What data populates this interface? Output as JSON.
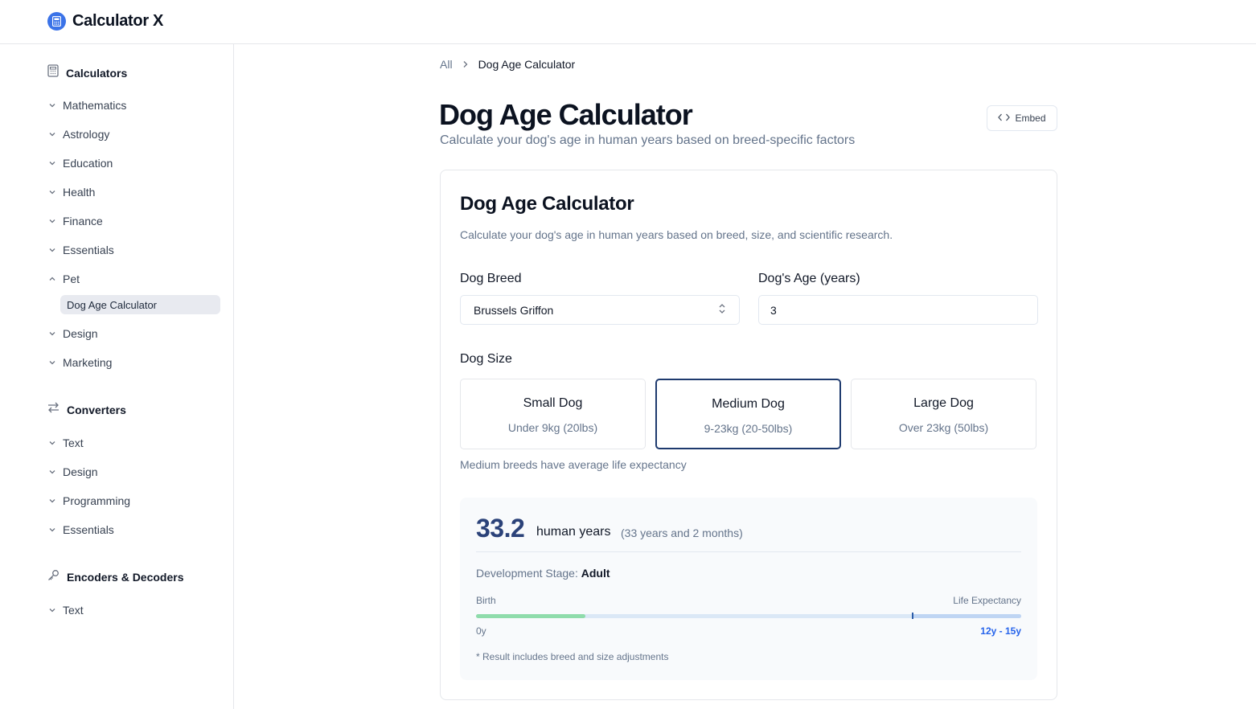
{
  "app": {
    "title": "Calculator X"
  },
  "sidebar": {
    "calculators": {
      "label": "Calculators",
      "items": [
        "Mathematics",
        "Astrology",
        "Education",
        "Health",
        "Finance",
        "Essentials",
        "Pet",
        "Design",
        "Marketing"
      ],
      "expanded": "Pet",
      "active_sub": "Dog Age Calculator"
    },
    "converters": {
      "label": "Converters",
      "items": [
        "Text",
        "Design",
        "Programming",
        "Essentials"
      ]
    },
    "encoders": {
      "label": "Encoders & Decoders",
      "items": [
        "Text"
      ]
    }
  },
  "breadcrumb": {
    "root": "All",
    "current": "Dog Age Calculator"
  },
  "page": {
    "title": "Dog Age Calculator",
    "subtitle": "Calculate your dog's age in human years based on breed-specific factors",
    "embed_label": "Embed"
  },
  "card": {
    "title": "Dog Age Calculator",
    "description": "Calculate your dog's age in human years based on breed, size, and scientific research."
  },
  "form": {
    "breed_label": "Dog Breed",
    "breed_value": "Brussels Griffon",
    "age_label": "Dog's Age (years)",
    "age_value": "3",
    "size_label": "Dog Size",
    "sizes": [
      {
        "name": "Small Dog",
        "range": "Under 9kg (20lbs)",
        "selected": false
      },
      {
        "name": "Medium Dog",
        "range": "9-23kg (20-50lbs)",
        "selected": true
      },
      {
        "name": "Large Dog",
        "range": "Over 23kg (50lbs)",
        "selected": false
      }
    ],
    "size_note": "Medium breeds have average life expectancy"
  },
  "result": {
    "value": "33.2",
    "unit": "human years",
    "detail": "(33 years and 2 months)",
    "stage_label": "Development Stage:",
    "stage_value": "Adult",
    "bar_left_label": "Birth",
    "bar_right_label": "Life Expectancy",
    "bar_min": "0y",
    "bar_max": "12y - 15y",
    "progress_fraction": 0.2,
    "expectancy_start_fraction": 0.8,
    "footnote": "* Result includes breed and size adjustments"
  },
  "colors": {
    "accent": "#2b4279",
    "logo": "#3b73e8",
    "progress_fill": "#8fdcab",
    "expectancy_zone": "#bfd5f3",
    "link_blue": "#2563eb"
  }
}
